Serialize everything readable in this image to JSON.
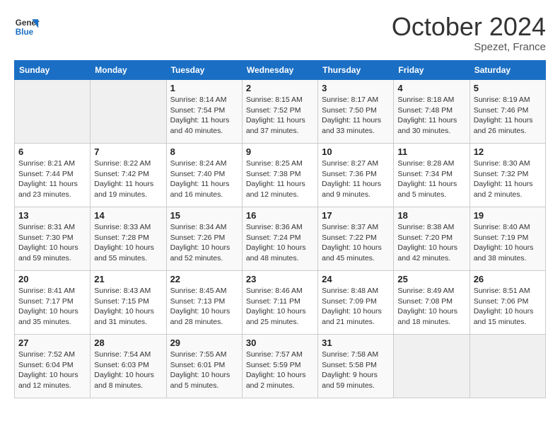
{
  "header": {
    "logo_general": "General",
    "logo_blue": "Blue",
    "month_title": "October 2024",
    "location": "Spezet, France"
  },
  "days_of_week": [
    "Sunday",
    "Monday",
    "Tuesday",
    "Wednesday",
    "Thursday",
    "Friday",
    "Saturday"
  ],
  "weeks": [
    [
      {
        "day": "",
        "empty": true
      },
      {
        "day": "",
        "empty": true
      },
      {
        "day": "1",
        "sunrise": "8:14 AM",
        "sunset": "7:54 PM",
        "daylight": "11 hours and 40 minutes."
      },
      {
        "day": "2",
        "sunrise": "8:15 AM",
        "sunset": "7:52 PM",
        "daylight": "11 hours and 37 minutes."
      },
      {
        "day": "3",
        "sunrise": "8:17 AM",
        "sunset": "7:50 PM",
        "daylight": "11 hours and 33 minutes."
      },
      {
        "day": "4",
        "sunrise": "8:18 AM",
        "sunset": "7:48 PM",
        "daylight": "11 hours and 30 minutes."
      },
      {
        "day": "5",
        "sunrise": "8:19 AM",
        "sunset": "7:46 PM",
        "daylight": "11 hours and 26 minutes."
      }
    ],
    [
      {
        "day": "6",
        "sunrise": "8:21 AM",
        "sunset": "7:44 PM",
        "daylight": "11 hours and 23 minutes."
      },
      {
        "day": "7",
        "sunrise": "8:22 AM",
        "sunset": "7:42 PM",
        "daylight": "11 hours and 19 minutes."
      },
      {
        "day": "8",
        "sunrise": "8:24 AM",
        "sunset": "7:40 PM",
        "daylight": "11 hours and 16 minutes."
      },
      {
        "day": "9",
        "sunrise": "8:25 AM",
        "sunset": "7:38 PM",
        "daylight": "11 hours and 12 minutes."
      },
      {
        "day": "10",
        "sunrise": "8:27 AM",
        "sunset": "7:36 PM",
        "daylight": "11 hours and 9 minutes."
      },
      {
        "day": "11",
        "sunrise": "8:28 AM",
        "sunset": "7:34 PM",
        "daylight": "11 hours and 5 minutes."
      },
      {
        "day": "12",
        "sunrise": "8:30 AM",
        "sunset": "7:32 PM",
        "daylight": "11 hours and 2 minutes."
      }
    ],
    [
      {
        "day": "13",
        "sunrise": "8:31 AM",
        "sunset": "7:30 PM",
        "daylight": "10 hours and 59 minutes."
      },
      {
        "day": "14",
        "sunrise": "8:33 AM",
        "sunset": "7:28 PM",
        "daylight": "10 hours and 55 minutes."
      },
      {
        "day": "15",
        "sunrise": "8:34 AM",
        "sunset": "7:26 PM",
        "daylight": "10 hours and 52 minutes."
      },
      {
        "day": "16",
        "sunrise": "8:36 AM",
        "sunset": "7:24 PM",
        "daylight": "10 hours and 48 minutes."
      },
      {
        "day": "17",
        "sunrise": "8:37 AM",
        "sunset": "7:22 PM",
        "daylight": "10 hours and 45 minutes."
      },
      {
        "day": "18",
        "sunrise": "8:38 AM",
        "sunset": "7:20 PM",
        "daylight": "10 hours and 42 minutes."
      },
      {
        "day": "19",
        "sunrise": "8:40 AM",
        "sunset": "7:19 PM",
        "daylight": "10 hours and 38 minutes."
      }
    ],
    [
      {
        "day": "20",
        "sunrise": "8:41 AM",
        "sunset": "7:17 PM",
        "daylight": "10 hours and 35 minutes."
      },
      {
        "day": "21",
        "sunrise": "8:43 AM",
        "sunset": "7:15 PM",
        "daylight": "10 hours and 31 minutes."
      },
      {
        "day": "22",
        "sunrise": "8:45 AM",
        "sunset": "7:13 PM",
        "daylight": "10 hours and 28 minutes."
      },
      {
        "day": "23",
        "sunrise": "8:46 AM",
        "sunset": "7:11 PM",
        "daylight": "10 hours and 25 minutes."
      },
      {
        "day": "24",
        "sunrise": "8:48 AM",
        "sunset": "7:09 PM",
        "daylight": "10 hours and 21 minutes."
      },
      {
        "day": "25",
        "sunrise": "8:49 AM",
        "sunset": "7:08 PM",
        "daylight": "10 hours and 18 minutes."
      },
      {
        "day": "26",
        "sunrise": "8:51 AM",
        "sunset": "7:06 PM",
        "daylight": "10 hours and 15 minutes."
      }
    ],
    [
      {
        "day": "27",
        "sunrise": "7:52 AM",
        "sunset": "6:04 PM",
        "daylight": "10 hours and 12 minutes."
      },
      {
        "day": "28",
        "sunrise": "7:54 AM",
        "sunset": "6:03 PM",
        "daylight": "10 hours and 8 minutes."
      },
      {
        "day": "29",
        "sunrise": "7:55 AM",
        "sunset": "6:01 PM",
        "daylight": "10 hours and 5 minutes."
      },
      {
        "day": "30",
        "sunrise": "7:57 AM",
        "sunset": "5:59 PM",
        "daylight": "10 hours and 2 minutes."
      },
      {
        "day": "31",
        "sunrise": "7:58 AM",
        "sunset": "5:58 PM",
        "daylight": "9 hours and 59 minutes."
      },
      {
        "day": "",
        "empty": true
      },
      {
        "day": "",
        "empty": true
      }
    ]
  ]
}
